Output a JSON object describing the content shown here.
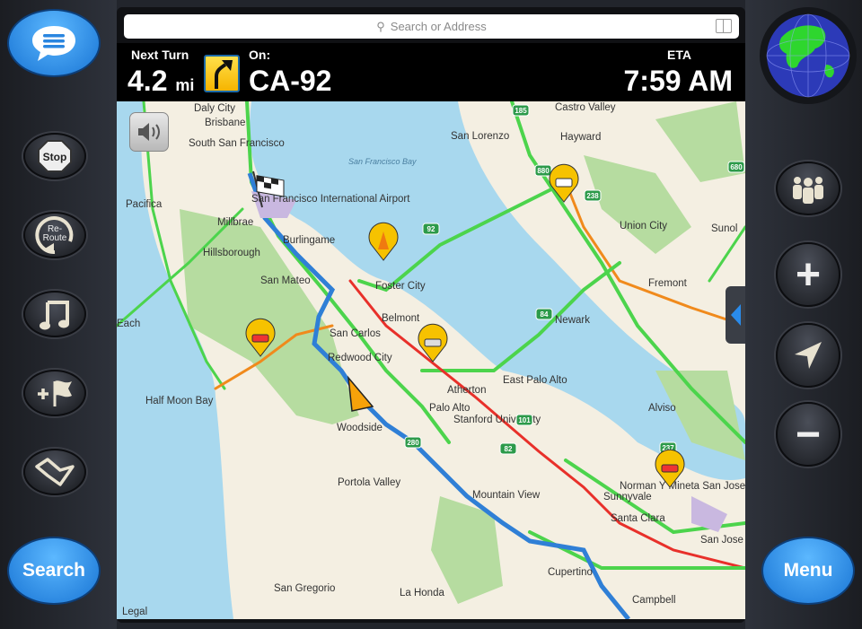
{
  "search": {
    "placeholder": "Search or Address",
    "icon": "magnifier-icon",
    "bookmarks_icon": "book-icon"
  },
  "nav": {
    "next_turn_label": "Next Turn",
    "distance": "4.2",
    "unit": "mi",
    "turn_icon": "bear-right-arrow-icon",
    "on_label": "On:",
    "road": "CA-92",
    "eta_label": "ETA",
    "eta": "7:59 AM"
  },
  "left_buttons": [
    {
      "name": "messages",
      "icon": "speech-bubble-icon"
    },
    {
      "name": "stop",
      "label": "Stop"
    },
    {
      "name": "reroute",
      "label": "Re-\nRoute",
      "line1": "Re-",
      "line2": "Route"
    },
    {
      "name": "music",
      "icon": "music-note-icon"
    },
    {
      "name": "add-waypoint",
      "icon": "plus-flag-icon"
    },
    {
      "name": "map-view",
      "icon": "folded-map-icon"
    },
    {
      "name": "search",
      "label": "Search"
    }
  ],
  "right_buttons": [
    {
      "name": "globe",
      "icon": "globe-icon"
    },
    {
      "name": "people",
      "icon": "people-icon"
    },
    {
      "name": "zoom-in",
      "label": "+"
    },
    {
      "name": "locate",
      "icon": "location-arrow-icon"
    },
    {
      "name": "zoom-out",
      "label": "−"
    },
    {
      "name": "menu",
      "label": "Menu"
    }
  ],
  "map": {
    "legal": "Legal",
    "places": [
      "Daly City",
      "Brisbane",
      "South San Francisco",
      "Pacifica",
      "Millbrae",
      "Burlingame",
      "Hillsborough",
      "San Mateo",
      "Foster City",
      "Belmont",
      "San Carlos",
      "Redwood City",
      "Half Moon Bay",
      "Woodside",
      "Atherton",
      "Palo Alto",
      "East Palo Alto",
      "Portola Valley",
      "Mountain View",
      "Sunnyvale",
      "Santa Clara",
      "San Jose",
      "Cupertino",
      "Campbell",
      "San Gregorio",
      "La Honda",
      "San Lorenzo",
      "Castro Valley",
      "Hayward",
      "Union City",
      "Sunol",
      "Fremont",
      "Newark",
      "Alviso",
      "Each"
    ],
    "water": [
      "San Francisco Bay"
    ],
    "pois": [
      "San Francisco International Airport",
      "Stanford University",
      "Norman Y Mineta San Jose International Airport"
    ],
    "shields": [
      "185",
      "880",
      "238",
      "92",
      "84",
      "101",
      "82",
      "280",
      "237",
      "680"
    ],
    "colors": {
      "route": "#2f7fd6",
      "traffic_free": "#4cd44c",
      "traffic_slow": "#f08a1c",
      "traffic_heavy": "#e8302a",
      "water": "#a8d8ee",
      "park": "#b6dca0"
    }
  }
}
